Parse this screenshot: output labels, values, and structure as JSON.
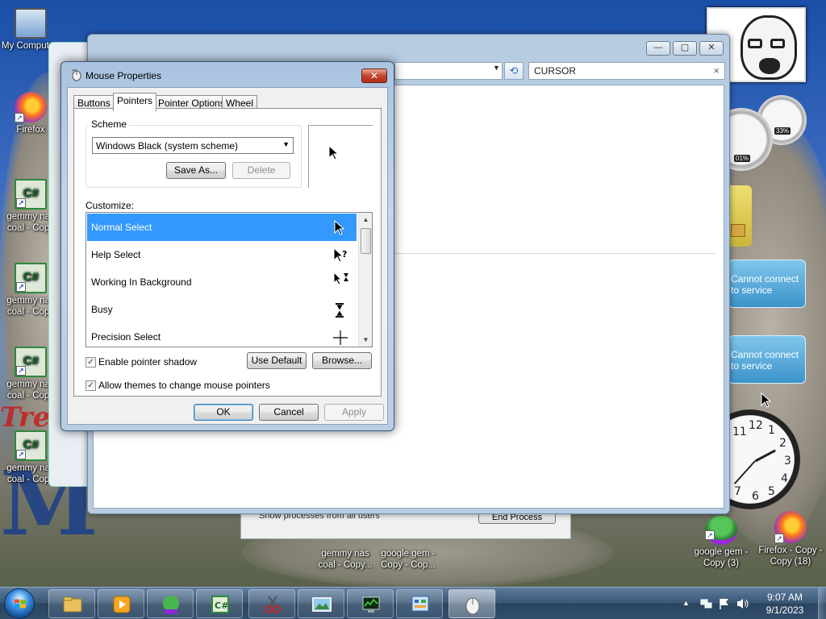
{
  "desktop": {
    "icons": [
      {
        "label": "My Computer",
        "kind": "pc"
      },
      {
        "label": "Firefox",
        "kind": "firefox"
      },
      {
        "label": "gemmy nas coal - Copy",
        "kind": "csharp"
      },
      {
        "label": "gemmy nas coal - Copy",
        "kind": "csharp"
      },
      {
        "label": "gemmy nas coal - Copy",
        "kind": "csharp"
      },
      {
        "label": "gemmy nas coal - Copy",
        "kind": "csharp"
      },
      {
        "label": "gemmy nas coal - Copy...",
        "kind": "csharp"
      },
      {
        "label": "google gem - Copy - Cop...",
        "kind": "frog"
      },
      {
        "label": "google gem - Copy (3)",
        "kind": "frog"
      },
      {
        "label": "Firefox - Copy - Copy (18)",
        "kind": "firefox"
      }
    ],
    "bg_text_left": "M",
    "bg_text_slogan": "Tre",
    "gadgets": {
      "cpu_meter_value": "33%",
      "cpu_meter_value2": "01%",
      "notification_1": "Cannot connect to service",
      "notification_2": "Cannot connect to service",
      "clock_numbers": [
        "11",
        "12",
        "1",
        "2",
        "3",
        "4",
        "5",
        "6",
        "7"
      ]
    }
  },
  "explorer_window": {
    "search_value": "CURSOR",
    "clear_glyph": "×",
    "controls": {
      "minimize": "—",
      "maximize": "▢",
      "close": "✕"
    },
    "refresh_glyph": "⟲"
  },
  "task_manager": {
    "checkbox_label": "Show processes from all users",
    "end_process_label": "End Process"
  },
  "dialog": {
    "title": "Mouse Properties",
    "close_glyph": "✕",
    "tabs": [
      {
        "label": "Buttons",
        "active": false
      },
      {
        "label": "Pointers",
        "active": true
      },
      {
        "label": "Pointer Options",
        "active": false
      },
      {
        "label": "Wheel",
        "active": false
      }
    ],
    "scheme": {
      "group_label": "Scheme",
      "selected": "Windows Black (system scheme)",
      "save_as_label": "Save As...",
      "delete_label": "Delete"
    },
    "customize_label": "Customize:",
    "pointers": [
      {
        "name": "Normal Select",
        "selected": true,
        "cursor": "arrow"
      },
      {
        "name": "Help Select",
        "selected": false,
        "cursor": "help"
      },
      {
        "name": "Working In Background",
        "selected": false,
        "cursor": "working"
      },
      {
        "name": "Busy",
        "selected": false,
        "cursor": "busy"
      },
      {
        "name": "Precision Select",
        "selected": false,
        "cursor": "cross"
      }
    ],
    "enable_shadow": {
      "label": "Enable pointer shadow",
      "checked": true
    },
    "allow_themes": {
      "label": "Allow themes to change mouse pointers",
      "checked": true
    },
    "use_default_label": "Use Default",
    "browse_label": "Browse...",
    "ok_label": "OK",
    "cancel_label": "Cancel",
    "apply_label": "Apply"
  },
  "taskbar": {
    "buttons": [
      "explorer",
      "media-player",
      "frog-app",
      "csharp-app",
      "snipping-tool",
      "picture-viewer",
      "task-manager",
      "control-panel",
      "mouse-properties"
    ],
    "active_index": 8,
    "tray_arrow": "▲",
    "time": "9:07 AM",
    "date": "9/1/2023"
  },
  "colors": {
    "selection": "#3399ff",
    "dialog_frame": "#b9cde3",
    "close_red": "#c3462d"
  }
}
